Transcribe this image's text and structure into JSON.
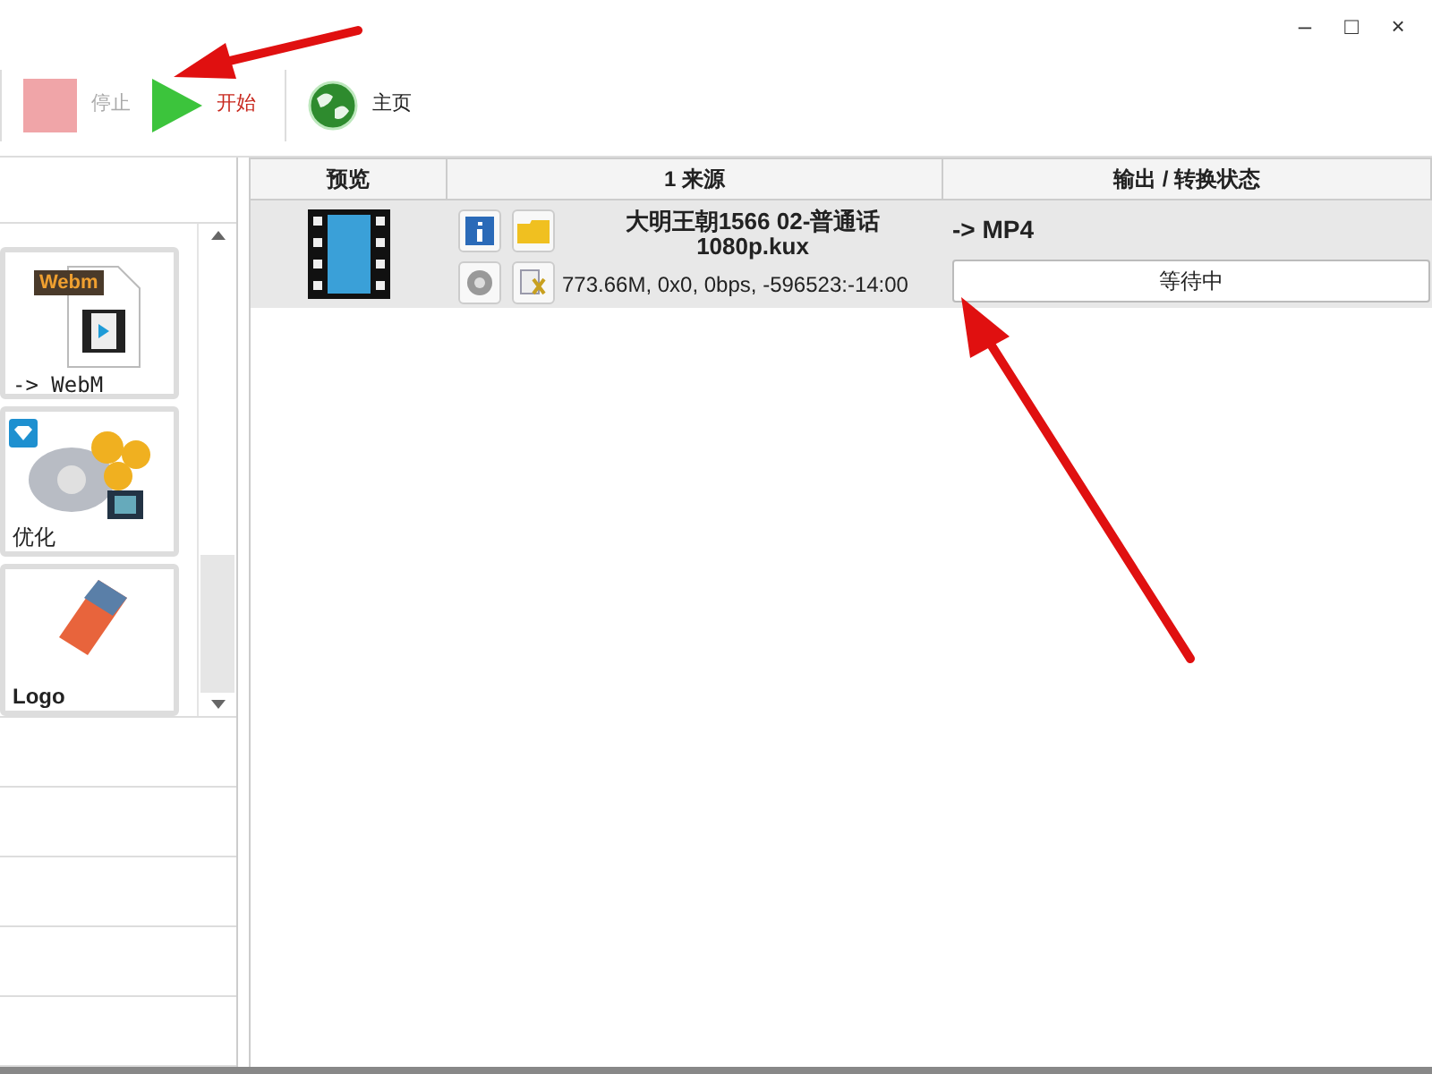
{
  "window": {
    "controls": [
      "–",
      "□",
      "×"
    ]
  },
  "toolbar": [
    {
      "kind": "stop",
      "label": "停止",
      "disabled": true
    },
    {
      "kind": "start",
      "label": "开始",
      "disabled": false
    },
    {
      "kind": "home",
      "label": "主页",
      "disabled": false
    }
  ],
  "sidebar": {
    "tiles": [
      {
        "kind": "webm",
        "badge": "Webm",
        "label": "-> WebM"
      },
      {
        "kind": "optimize",
        "label": "优化"
      },
      {
        "kind": "logo",
        "label": "Logo"
      }
    ]
  },
  "table": {
    "columns": [
      "预览",
      "1 来源",
      "输出 / 转换状态"
    ],
    "rows": [
      {
        "title": "大明王朝1566 02-普通话",
        "subtitle": "1080p.kux",
        "info": "773.66M, 0x0, 0bps, -596523:-14:00",
        "output": "-> MP4",
        "status": "等待中",
        "selected": true
      }
    ]
  },
  "annotations": [
    {
      "kind": "arrow"
    },
    {
      "kind": "arrow"
    }
  ]
}
